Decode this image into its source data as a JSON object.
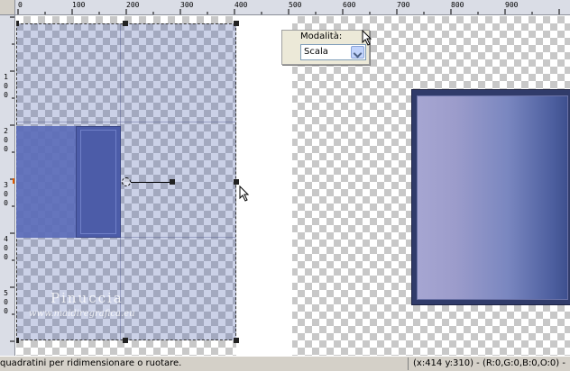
{
  "ruler": {
    "top_labels": [
      "0",
      "100",
      "200",
      "300",
      "400",
      "500",
      "600",
      "700",
      "800",
      "900"
    ],
    "left_labels": [
      "1",
      "0",
      "0",
      "2",
      "0",
      "0",
      "3",
      "0",
      "0",
      "4",
      "0",
      "0",
      "5",
      "0",
      "0"
    ]
  },
  "mode_panel": {
    "label": "Modalità:",
    "selected": "Scala"
  },
  "watermark": {
    "title": "Pinuccia",
    "url": "www.maidiregrafica.eu"
  },
  "status_bar": {
    "hint": "quadratini per ridimensionare o ruotare.",
    "coords": "(x:414 y:310) - (R:0,G:0,B:0,O:0) -"
  },
  "colors": {
    "accent": "#4c5ca8",
    "preview_dark": "#303b6a",
    "overlay": "#465aaa"
  },
  "icons": {
    "cursor": "arrow-cursor-icon",
    "dropdown": "chevron-down-icon",
    "pivot": "rotation-pivot-icon"
  }
}
